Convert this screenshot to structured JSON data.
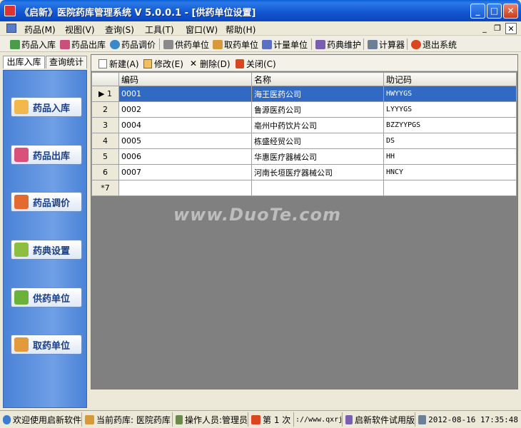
{
  "window": {
    "title": "《启新》医院药库管理系统 V 5.0.0.1 - [供药单位设置]"
  },
  "menubar": {
    "items": [
      "药品(M)",
      "视图(V)",
      "查询(S)",
      "工具(T)",
      "窗口(W)",
      "帮助(H)"
    ]
  },
  "toolbar": {
    "items": [
      "药品入库",
      "药品出库",
      "药品调价",
      "供药单位",
      "取药单位",
      "计量单位",
      "药典维护",
      "计算器",
      "退出系统"
    ]
  },
  "leftpanel": {
    "tabs": [
      "出库入库",
      "查询统计"
    ],
    "buttons": [
      "药品入库",
      "药品出库",
      "药品调价",
      "药典设置",
      "供药单位",
      "取药单位"
    ]
  },
  "subtoolbar": {
    "items": [
      "新建(A)",
      "修改(E)",
      "删除(D)",
      "关闭(C)"
    ]
  },
  "grid": {
    "columns": [
      "编码",
      "名称",
      "助记码"
    ],
    "rows": [
      {
        "num": "1",
        "code": "0001",
        "name": "海王医药公司",
        "mnemonic": "HWYYGS"
      },
      {
        "num": "2",
        "code": "0002",
        "name": "鲁源医药公司",
        "mnemonic": "LYYYGS"
      },
      {
        "num": "3",
        "code": "0004",
        "name": "亳州中药饮片公司",
        "mnemonic": "BZZYYPGS"
      },
      {
        "num": "4",
        "code": "0005",
        "name": "栋盛经贸公司",
        "mnemonic": "DS"
      },
      {
        "num": "5",
        "code": "0006",
        "name": "华惠医疗器械公司",
        "mnemonic": "HH"
      },
      {
        "num": "6",
        "code": "0007",
        "name": "河南长垣医疗器械公司",
        "mnemonic": "HNCY"
      }
    ],
    "new_row": "*7",
    "selected_marker": "▶"
  },
  "watermark": "www.DuoTe.com",
  "statusbar": {
    "welcome": "欢迎使用启新软件",
    "warehouse": "当前药库: 医院药库",
    "operator": "操作人员:管理员",
    "login_count": "第 1 次",
    "url": "://www.qxrj",
    "edition": "启新软件试用版",
    "datetime": "2012-08-16 17:35:48"
  },
  "colors": {
    "titlebar": "#1458d1",
    "selection": "#316ac5",
    "nav_panel": "#4a82d6",
    "grid_bg": "#808080"
  }
}
